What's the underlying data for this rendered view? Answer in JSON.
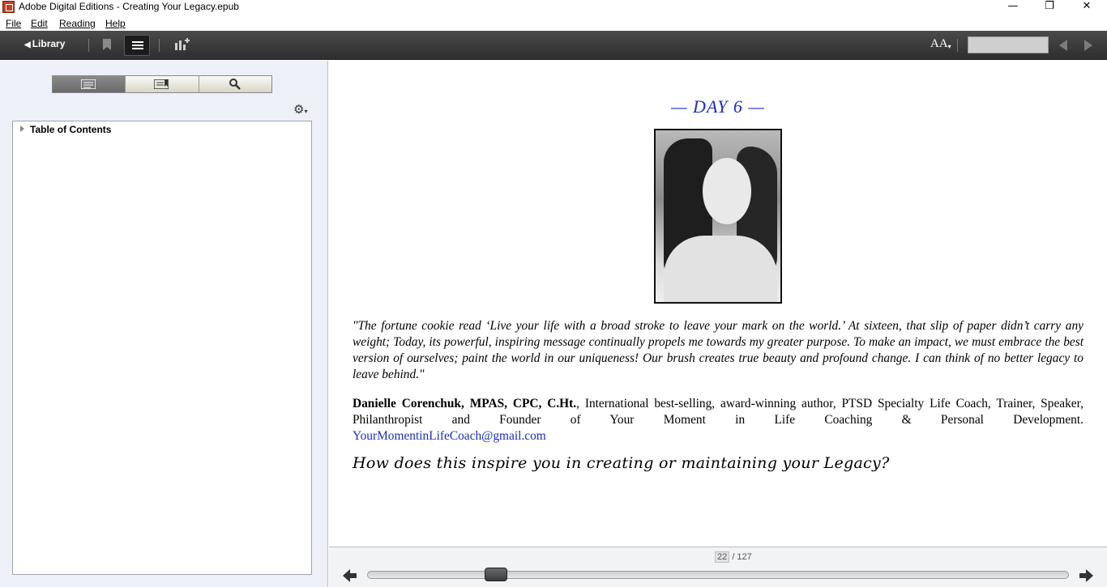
{
  "window": {
    "title": "Adobe Digital Editions - Creating Your Legacy.epub",
    "minimize": "—",
    "maximize": "❐",
    "close": "✕"
  },
  "menu": {
    "file": "File",
    "edit": "Edit",
    "reading": "Reading",
    "help": "Help"
  },
  "toolbar": {
    "library_label": "Library",
    "font_size_label": "AA",
    "search_placeholder": ""
  },
  "sidebar": {
    "toc_label": "Table of Contents"
  },
  "book": {
    "day_title": "— DAY 6 —",
    "quote": "\"The fortune cookie read ‘Live your life with a broad stroke to leave your mark on the world.’ At sixteen, that slip of paper didn’t carry any weight; Today, its powerful, inspiring message continually propels me towards my greater purpose. To make an impact, we must embrace the best version of ourselves; paint the world in our uniqueness! Our brush creates true beauty and profound change. I can think of no better legacy to leave behind.\"",
    "author_name": "Danielle Corenchuk, MPAS, CPC, C.Ht.",
    "author_bio": ", International best-selling, award-winning author, PTSD Specialty Life Coach, Trainer, Speaker, Philanthropist and Founder of Your Moment in Life Coaching & Personal Development.",
    "email": "YourMomentinLifeCoach@gmail.com",
    "question": "How does this inspire you in creating or maintaining your Legacy?"
  },
  "pagination": {
    "current_page": "22",
    "total_pages": "/ 127",
    "progress_fraction": 0.173
  },
  "colors": {
    "accent_blue": "#1a2fc0",
    "toolbar_dark": "#3a3a3a"
  }
}
